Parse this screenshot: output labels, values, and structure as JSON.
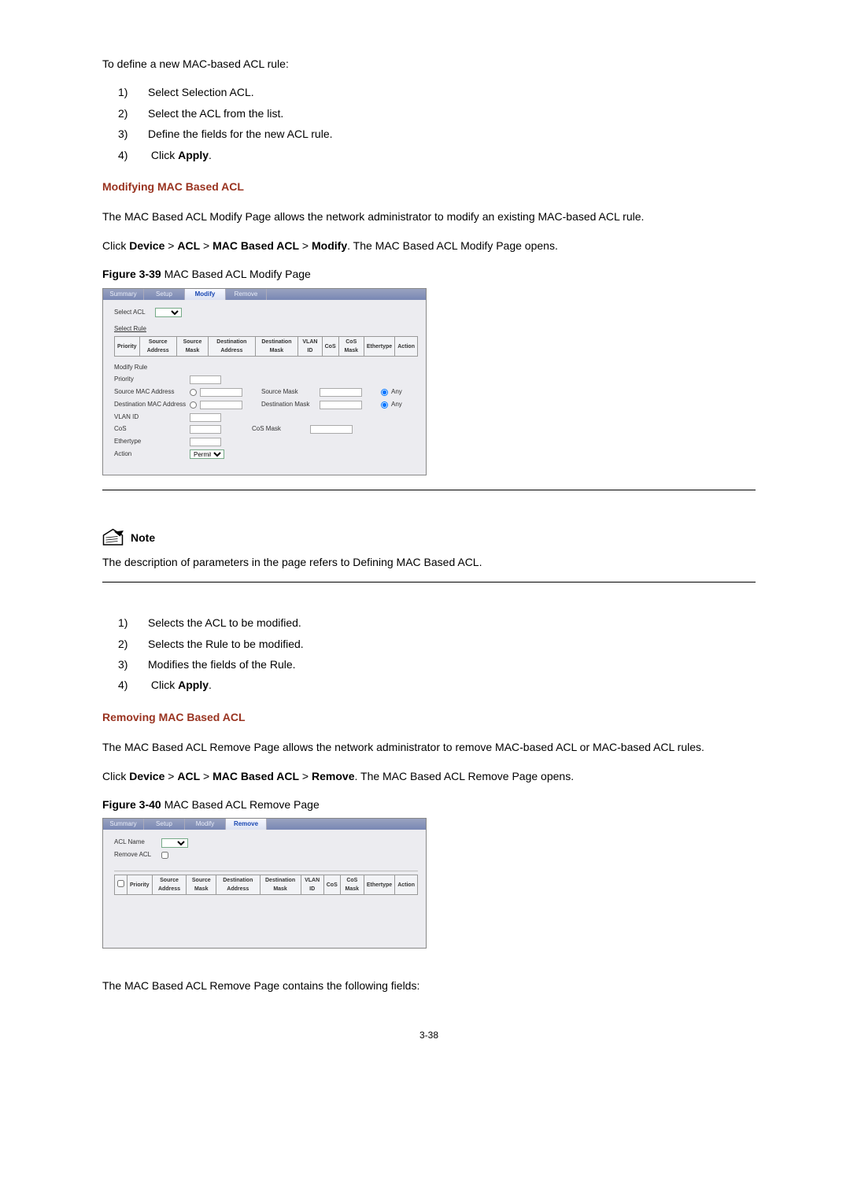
{
  "intro": {
    "lead": "To define a new MAC-based ACL rule:",
    "steps": [
      "Select Selection ACL.",
      "Select the ACL from the list.",
      "Define the fields for the new ACL rule."
    ],
    "last_step_prefix": "Click ",
    "last_step_bold": "Apply",
    "last_step_suffix": "."
  },
  "modify": {
    "heading": "Modifying MAC Based ACL",
    "para1": "The MAC Based ACL Modify Page allows the network administrator to modify an existing MAC-based ACL rule.",
    "nav_prefix": "Click ",
    "nav_b1": "Device",
    "nav_sep": " > ",
    "nav_b2": "ACL",
    "nav_b3": "MAC Based ACL",
    "nav_b4": "Modify",
    "nav_suffix": ". The MAC Based ACL Modify Page opens.",
    "figcap_b": "Figure 3-39",
    "figcap_t": " MAC Based ACL Modify Page",
    "tabs": {
      "summary": "Summary",
      "setup": "Setup",
      "modify": "Modify",
      "remove": "Remove"
    },
    "labels": {
      "select_acl": "Select ACL",
      "select_rule": "Select Rule",
      "modify_rule": "Modify Rule",
      "priority": "Priority",
      "src_mac": "Source MAC Address",
      "src_mask": "Source Mask",
      "any": "Any",
      "dst_mac": "Destination MAC Address",
      "dst_mask": "Destination Mask",
      "vlan": "VLAN ID",
      "cos": "CoS",
      "cos_mask": "CoS Mask",
      "eth": "Ethertype",
      "action": "Action",
      "action_val": "Permit"
    },
    "table_headers": [
      "Priority",
      "Source Address",
      "Source Mask",
      "Destination Address",
      "Destination Mask",
      "VLAN ID",
      "CoS",
      "CoS Mask",
      "Ethertype",
      "Action"
    ]
  },
  "note": {
    "label": "Note",
    "text": "The description of parameters in the page refers to Defining MAC Based ACL."
  },
  "steps2": {
    "items": [
      "Selects the ACL to be modified.",
      "Selects the Rule to be modified.",
      "Modifies the fields of the Rule."
    ],
    "last_prefix": "Click ",
    "last_bold": "Apply",
    "last_suffix": "."
  },
  "remove": {
    "heading": "Removing MAC Based ACL",
    "para1": "The MAC Based ACL Remove Page allows the network administrator to remove MAC-based ACL or MAC-based ACL rules.",
    "nav_prefix": "Click ",
    "nav_b1": "Device",
    "nav_sep": " > ",
    "nav_b2": "ACL",
    "nav_b3": "MAC Based ACL",
    "nav_b4": "Remove",
    "nav_suffix": ". The MAC Based ACL Remove Page opens.",
    "figcap_b": "Figure 3-40",
    "figcap_t": " MAC Based ACL Remove Page",
    "labels": {
      "acl_name": "ACL Name",
      "remove_acl": "Remove ACL"
    },
    "table_headers": [
      "",
      "Priority",
      "Source Address",
      "Source Mask",
      "Destination Address",
      "Destination Mask",
      "VLAN ID",
      "CoS",
      "CoS Mask",
      "Ethertype",
      "Action"
    ],
    "trailing": "The MAC Based ACL Remove Page contains the following fields:"
  },
  "page_num": "3-38"
}
